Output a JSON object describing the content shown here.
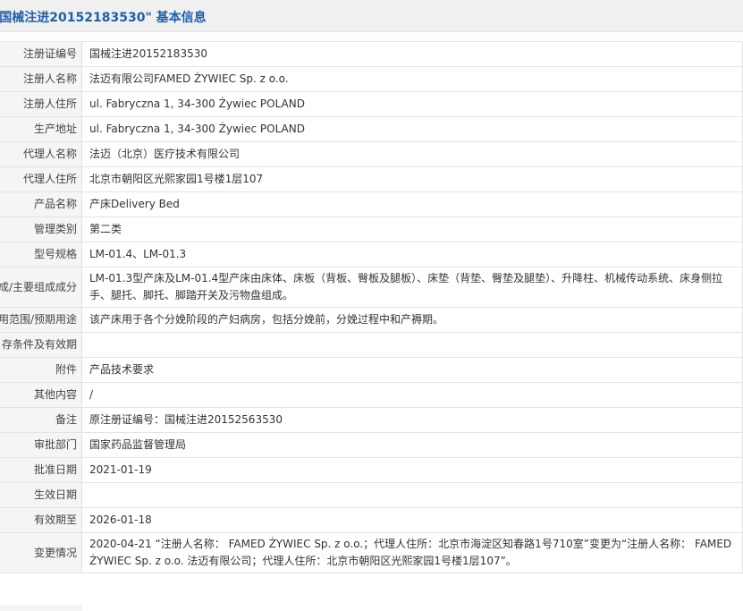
{
  "header": {
    "title": "\"国械注进20152183530\" 基本信息"
  },
  "rows": [
    {
      "label": "注册证编号",
      "value": "国械注进20152183530"
    },
    {
      "label": "注册人名称",
      "value": "法迈有限公司FAMED ŻYWIEC Sp. z o.o."
    },
    {
      "label": "注册人住所",
      "value": "ul. Fabryczna 1, 34-300 Żywiec POLAND"
    },
    {
      "label": "生产地址",
      "value": "ul. Fabryczna 1, 34-300 Żywiec POLAND"
    },
    {
      "label": "代理人名称",
      "value": "法迈（北京）医疗技术有限公司"
    },
    {
      "label": "代理人住所",
      "value": "北京市朝阳区光熙家园1号楼1层107"
    },
    {
      "label": "产品名称",
      "value": "产床Delivery Bed"
    },
    {
      "label": "管理类别",
      "value": "第二类"
    },
    {
      "label": "型号规格",
      "value": "LM-01.4、LM-01.3"
    },
    {
      "label": "成/主要组成成分",
      "value": "LM-01.3型产床及LM-01.4型产床由床体、床板（背板、臀板及腿板）、床垫（背垫、臀垫及腿垫）、升降柱、机械传动系统、床身侧拉手、腿托、脚托、脚踏开关及污物盘组成。"
    },
    {
      "label": "用范围/预期用途",
      "value": "该产床用于各个分娩阶段的产妇病房，包括分娩前，分娩过程中和产褥期。"
    },
    {
      "label": "存条件及有效期",
      "value": ""
    },
    {
      "label": "附件",
      "value": "产品技术要求"
    },
    {
      "label": "其他内容",
      "value": "/"
    },
    {
      "label": "备注",
      "value": "原注册证编号：国械注进20152563530"
    },
    {
      "label": "审批部门",
      "value": "国家药品监督管理局"
    },
    {
      "label": "批准日期",
      "value": "2021-01-19"
    },
    {
      "label": "生效日期",
      "value": ""
    },
    {
      "label": "有效期至",
      "value": "2026-01-18"
    },
    {
      "label": "变更情况",
      "value": "2020-04-21 “注册人名称： FAMED ŻYWIEC Sp. z o.o.；代理人住所：北京市海淀区知春路1号710室”变更为“注册人名称： FAMED ŻYWIEC Sp. z o.o. 法迈有限公司；代理人住所：北京市朝阳区光熙家园1号楼1层107”。"
    }
  ]
}
